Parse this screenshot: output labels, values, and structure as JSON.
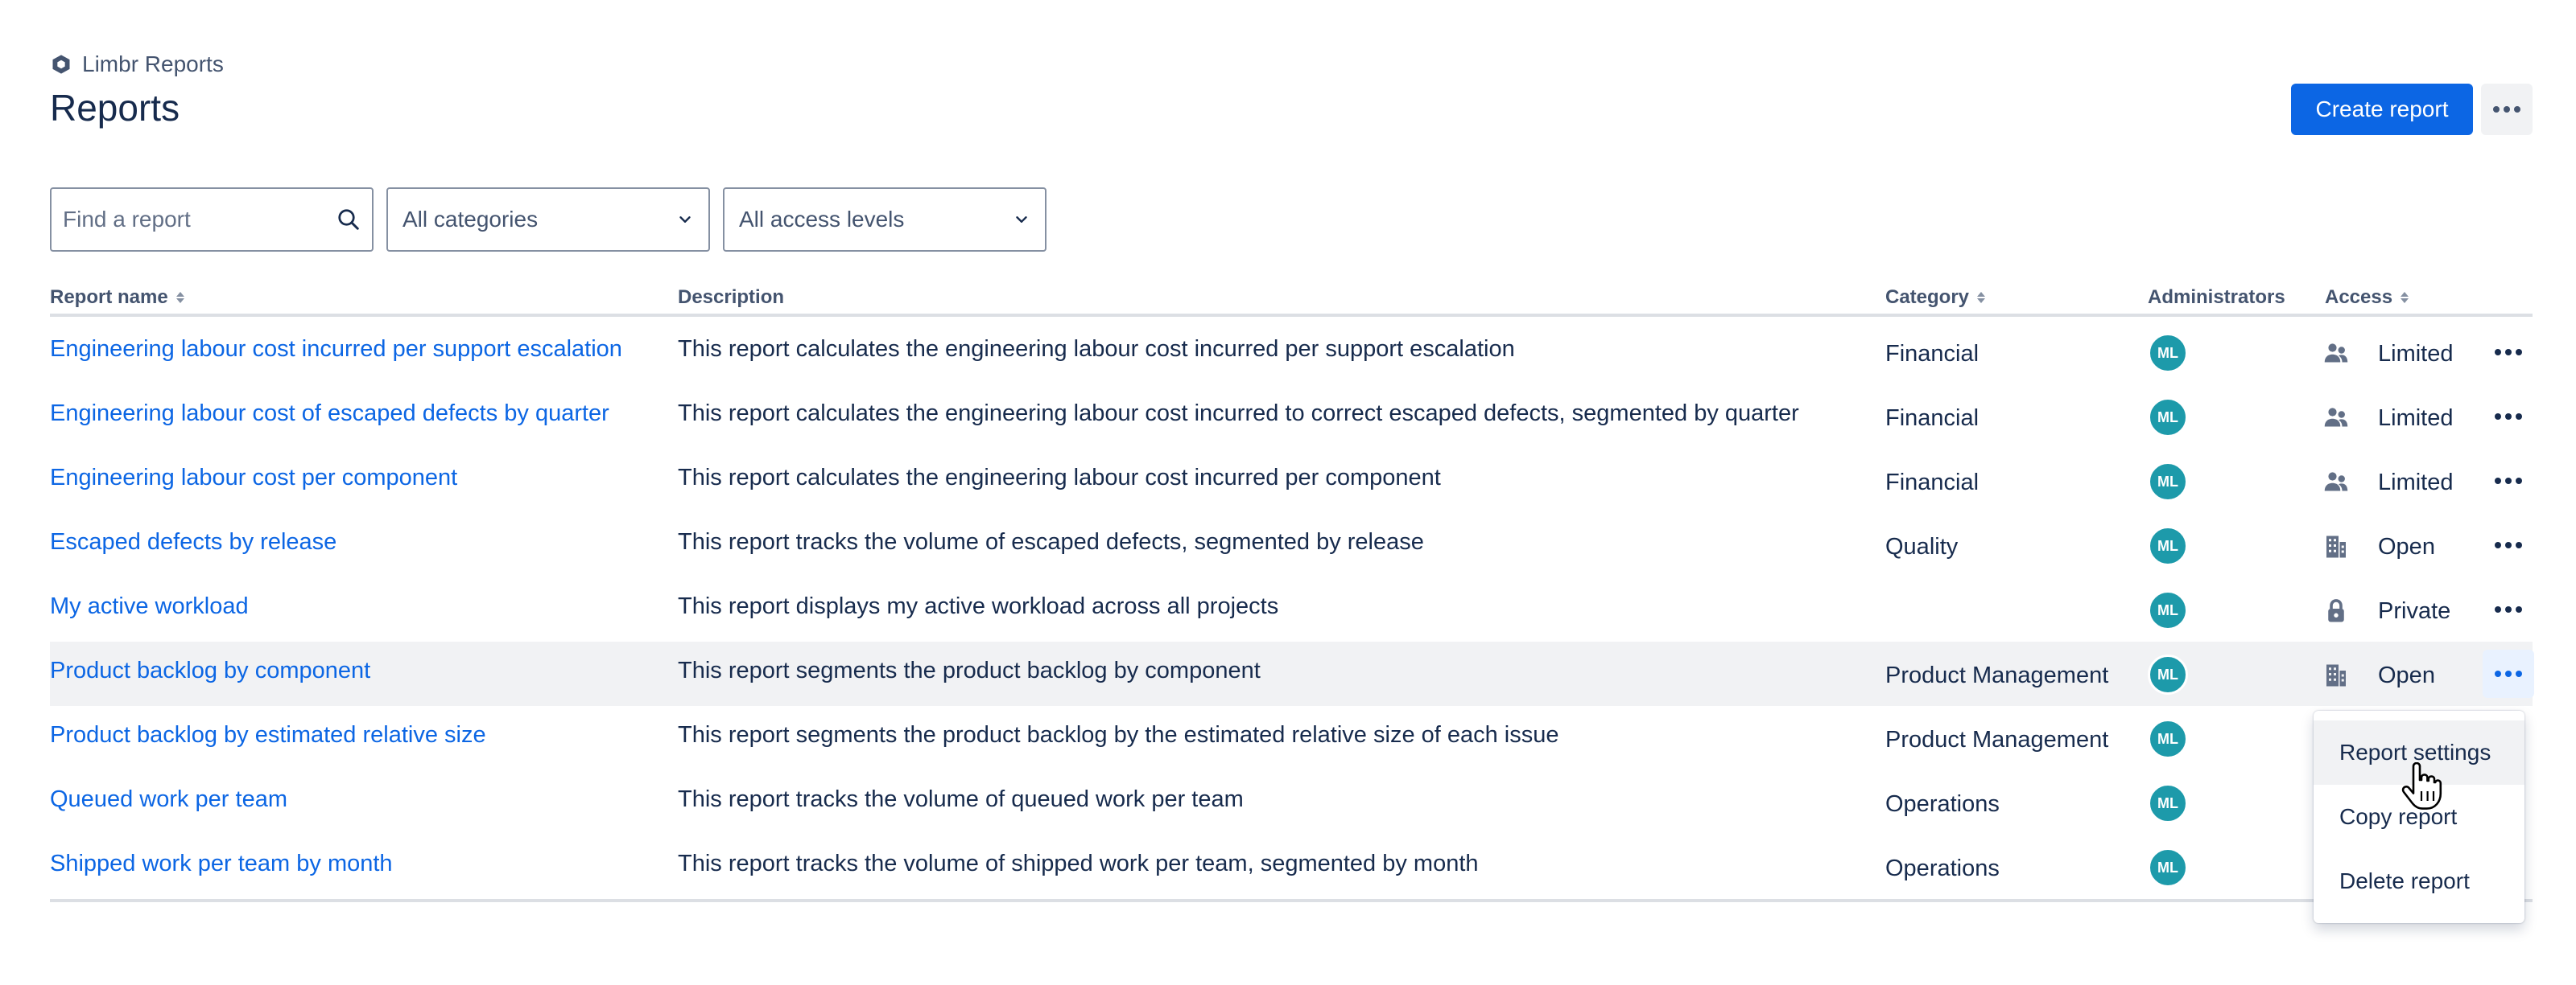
{
  "app": {
    "name": "Limbr Reports"
  },
  "page": {
    "title": "Reports"
  },
  "header": {
    "create_label": "Create report",
    "more_icon": "more-horizontal-icon"
  },
  "filters": {
    "search_placeholder": "Find a report",
    "category_select": "All categories",
    "access_select": "All access levels"
  },
  "columns": {
    "name": "Report name",
    "description": "Description",
    "category": "Category",
    "administrators": "Administrators",
    "access": "Access"
  },
  "rows": [
    {
      "name": "Engineering labour cost incurred per support escalation",
      "description": "This report calculates the engineering labour cost incurred per support escalation",
      "category": "Financial",
      "admin": "ML",
      "access": "Limited",
      "access_icon": "people-icon"
    },
    {
      "name": "Engineering labour cost of escaped defects by quarter",
      "description": "This report calculates the engineering labour cost incurred to correct escaped defects, segmented by quarter",
      "category": "Financial",
      "admin": "ML",
      "access": "Limited",
      "access_icon": "people-icon"
    },
    {
      "name": "Engineering labour cost per component",
      "description": "This report calculates the engineering labour cost incurred per component",
      "category": "Financial",
      "admin": "ML",
      "access": "Limited",
      "access_icon": "people-icon"
    },
    {
      "name": "Escaped defects by release",
      "description": "This report tracks the volume of escaped defects, segmented by release",
      "category": "Quality",
      "admin": "ML",
      "access": "Open",
      "access_icon": "office-building-icon"
    },
    {
      "name": "My active workload",
      "description": "This report displays my active workload across all projects",
      "category": "",
      "admin": "ML",
      "access": "Private",
      "access_icon": "lock-icon"
    },
    {
      "name": "Product backlog by component",
      "description": "This report segments the product backlog by component",
      "category": "Product Management",
      "admin": "ML",
      "access": "Open",
      "access_icon": "office-building-icon"
    },
    {
      "name": "Product backlog by estimated relative size",
      "description": "This report segments the product backlog by the estimated relative size of each issue",
      "category": "Product Management",
      "admin": "ML",
      "access": "",
      "access_icon": ""
    },
    {
      "name": "Queued work per team",
      "description": "This report tracks the volume of queued work per team",
      "category": "Operations",
      "admin": "ML",
      "access": "",
      "access_icon": ""
    },
    {
      "name": "Shipped work per team by month",
      "description": "This report tracks the volume of shipped work per team, segmented by month",
      "category": "Operations",
      "admin": "ML",
      "access": "",
      "access_icon": ""
    }
  ],
  "row_menu": {
    "items": [
      "Report settings",
      "Copy report",
      "Delete report"
    ],
    "highlighted": "Report settings"
  },
  "colors": {
    "accent": "#0c66e4",
    "avatar": "#1d9aaa",
    "hover_row": "#f1f2f4"
  }
}
